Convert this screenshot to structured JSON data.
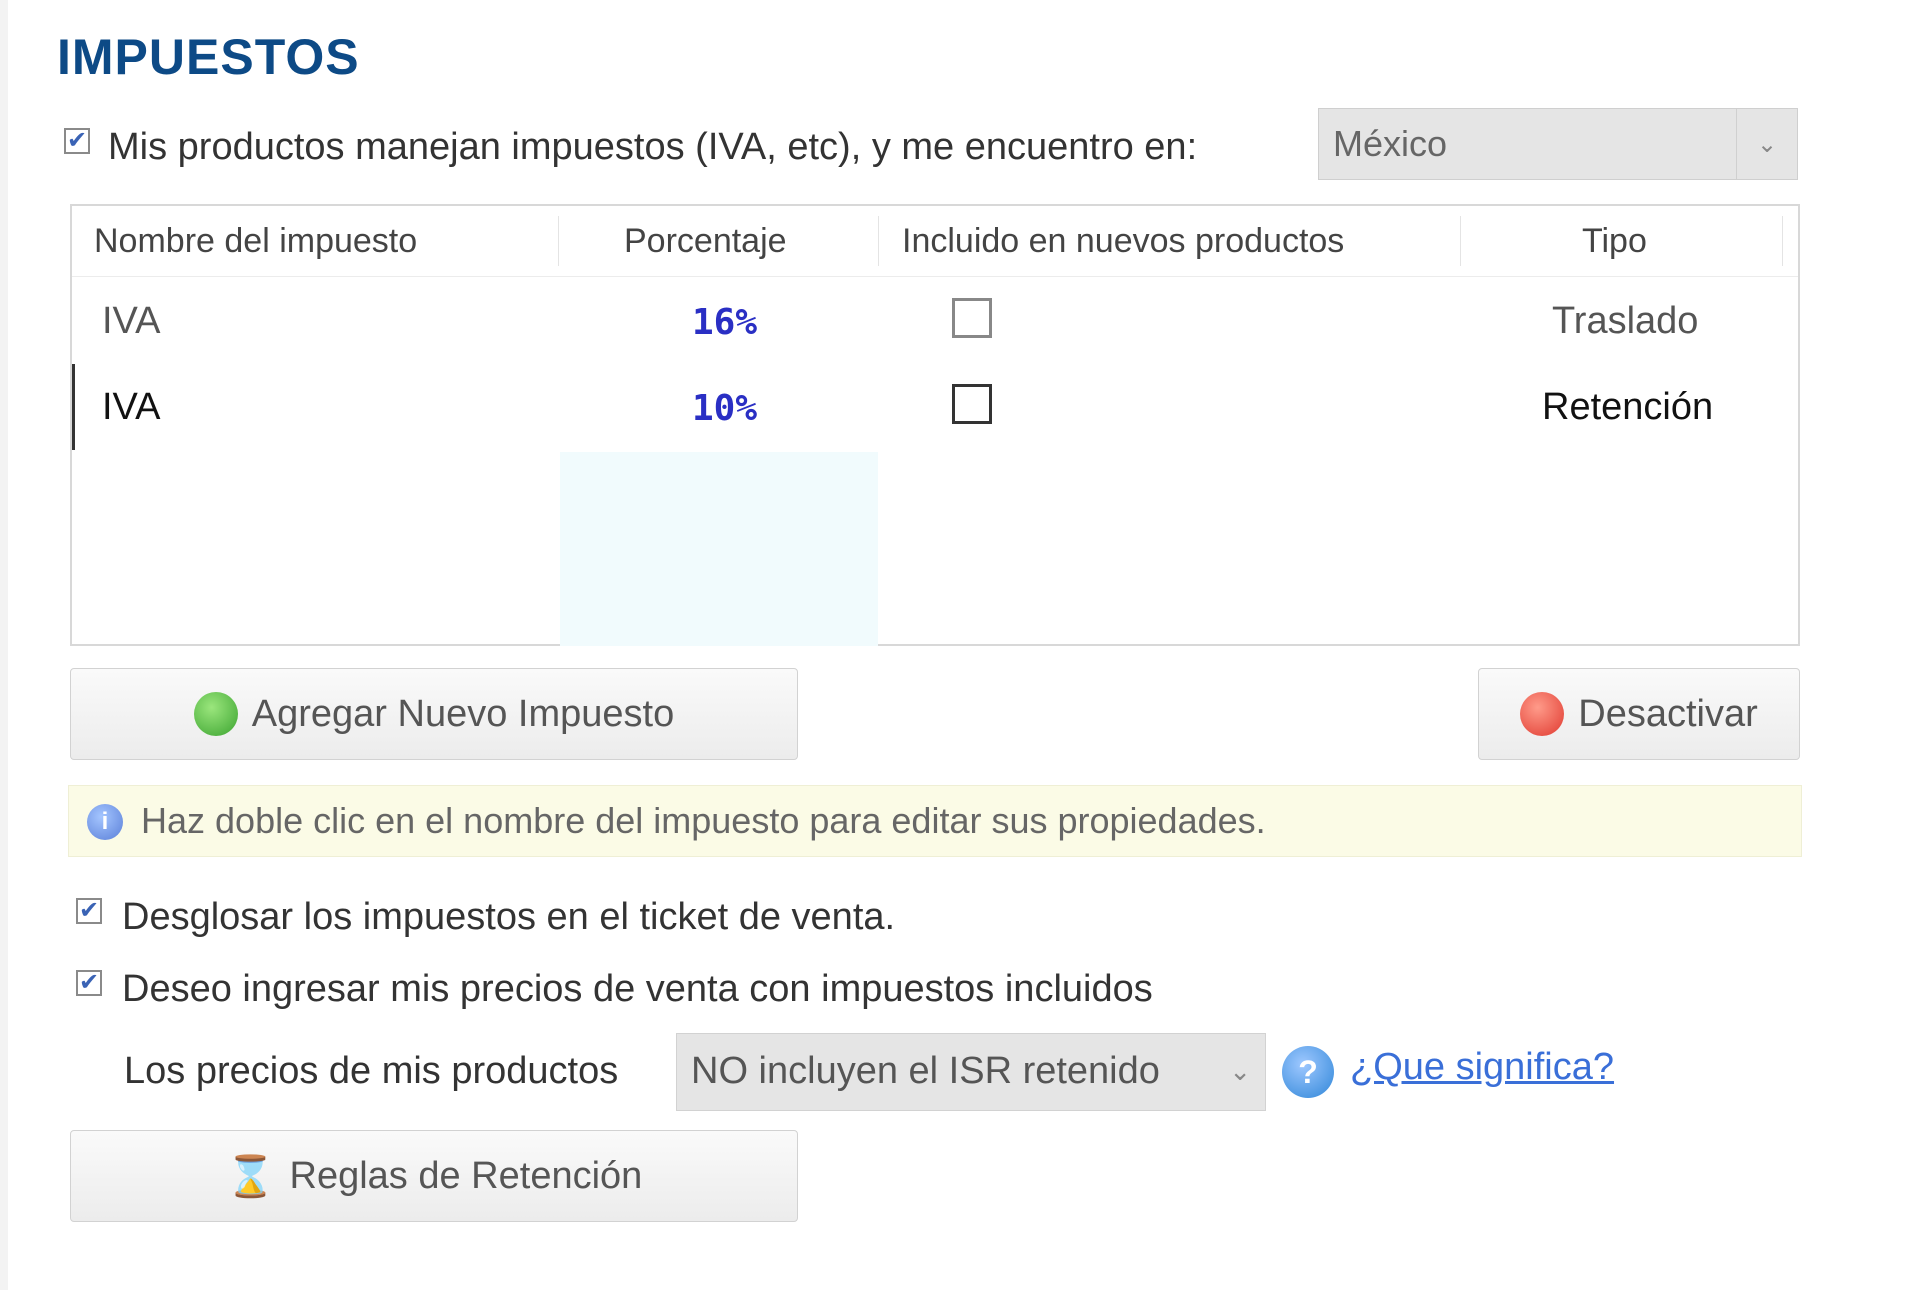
{
  "section_title": "IMPUESTOS",
  "country_row": {
    "checked": true,
    "label": "Mis productos manejan impuestos (IVA, etc), y me encuentro en:",
    "selected_country": "México"
  },
  "taxes_table": {
    "columns": [
      "Nombre del impuesto",
      "Porcentaje",
      "Incluido en nuevos productos",
      "Tipo"
    ],
    "rows": [
      {
        "name": "IVA",
        "percentage": "16%",
        "included": false,
        "type": "Traslado"
      },
      {
        "name": "IVA",
        "percentage": "10%",
        "included": false,
        "type": "Retención"
      }
    ]
  },
  "buttons": {
    "add_tax": "Agregar Nuevo Impuesto",
    "deactivate": "Desactivar",
    "retention_rules": "Reglas de Retención"
  },
  "hint": "Haz doble clic en el nombre del impuesto para editar sus propiedades.",
  "options": {
    "breakdown_label": "Desglosar los impuestos en el ticket de venta.",
    "breakdown_checked": true,
    "prices_with_taxes_label": "Deseo ingresar mis precios de venta con impuestos incluidos",
    "prices_with_taxes_checked": true
  },
  "isr_row": {
    "label": "Los precios de mis productos",
    "selected": "NO incluyen el ISR retenido",
    "help_link": "¿Que significa?"
  },
  "colors": {
    "title": "#0d4a86",
    "percentage_text": "#2a2fc4",
    "link": "#3a6fd8",
    "hint_background": "#fbfbe6"
  },
  "icons": {
    "add": "green-plus-circle-icon",
    "deactivate": "red-circle-icon",
    "hint": "info-bulb-icon",
    "help": "question-circle-icon",
    "retention_rules": "hourglass-icon"
  }
}
